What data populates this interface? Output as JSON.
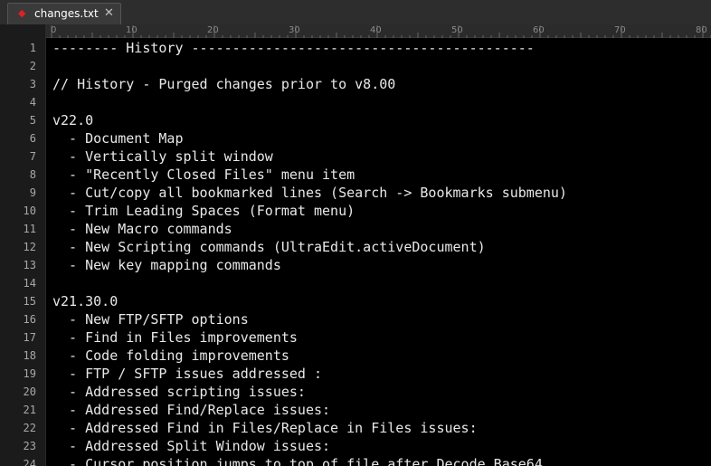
{
  "tab": {
    "title": "changes.txt",
    "close_glyph": "✕",
    "modified_glyph": "◆"
  },
  "ruler": {
    "labels": [
      "0",
      "10",
      "20",
      "30",
      "40",
      "50",
      "60",
      "70",
      "80"
    ]
  },
  "lines": [
    {
      "n": "1",
      "text": "-------- History ------------------------------------------"
    },
    {
      "n": "2",
      "text": ""
    },
    {
      "n": "3",
      "text": "// History - Purged changes prior to v8.00"
    },
    {
      "n": "4",
      "text": ""
    },
    {
      "n": "5",
      "text": "v22.0"
    },
    {
      "n": "6",
      "text": "  - Document Map"
    },
    {
      "n": "7",
      "text": "  - Vertically split window"
    },
    {
      "n": "8",
      "text": "  - \"Recently Closed Files\" menu item"
    },
    {
      "n": "9",
      "text": "  - Cut/copy all bookmarked lines (Search -> Bookmarks submenu)"
    },
    {
      "n": "10",
      "text": "  - Trim Leading Spaces (Format menu)"
    },
    {
      "n": "11",
      "text": "  - New Macro commands"
    },
    {
      "n": "12",
      "text": "  - New Scripting commands (UltraEdit.activeDocument)"
    },
    {
      "n": "13",
      "text": "  - New key mapping commands"
    },
    {
      "n": "14",
      "text": ""
    },
    {
      "n": "15",
      "text": "v21.30.0"
    },
    {
      "n": "16",
      "text": "  - New FTP/SFTP options"
    },
    {
      "n": "17",
      "text": "  - Find in Files improvements"
    },
    {
      "n": "18",
      "text": "  - Code folding improvements"
    },
    {
      "n": "19",
      "text": "  - FTP / SFTP issues addressed :"
    },
    {
      "n": "20",
      "text": "  - Addressed scripting issues:"
    },
    {
      "n": "21",
      "text": "  - Addressed Find/Replace issues:"
    },
    {
      "n": "22",
      "text": "  - Addressed Find in Files/Replace in Files issues:"
    },
    {
      "n": "23",
      "text": "  - Addressed Split Window issues:"
    },
    {
      "n": "24",
      "text": "  - Cursor position jumps to top of file after Decode Base64"
    }
  ]
}
